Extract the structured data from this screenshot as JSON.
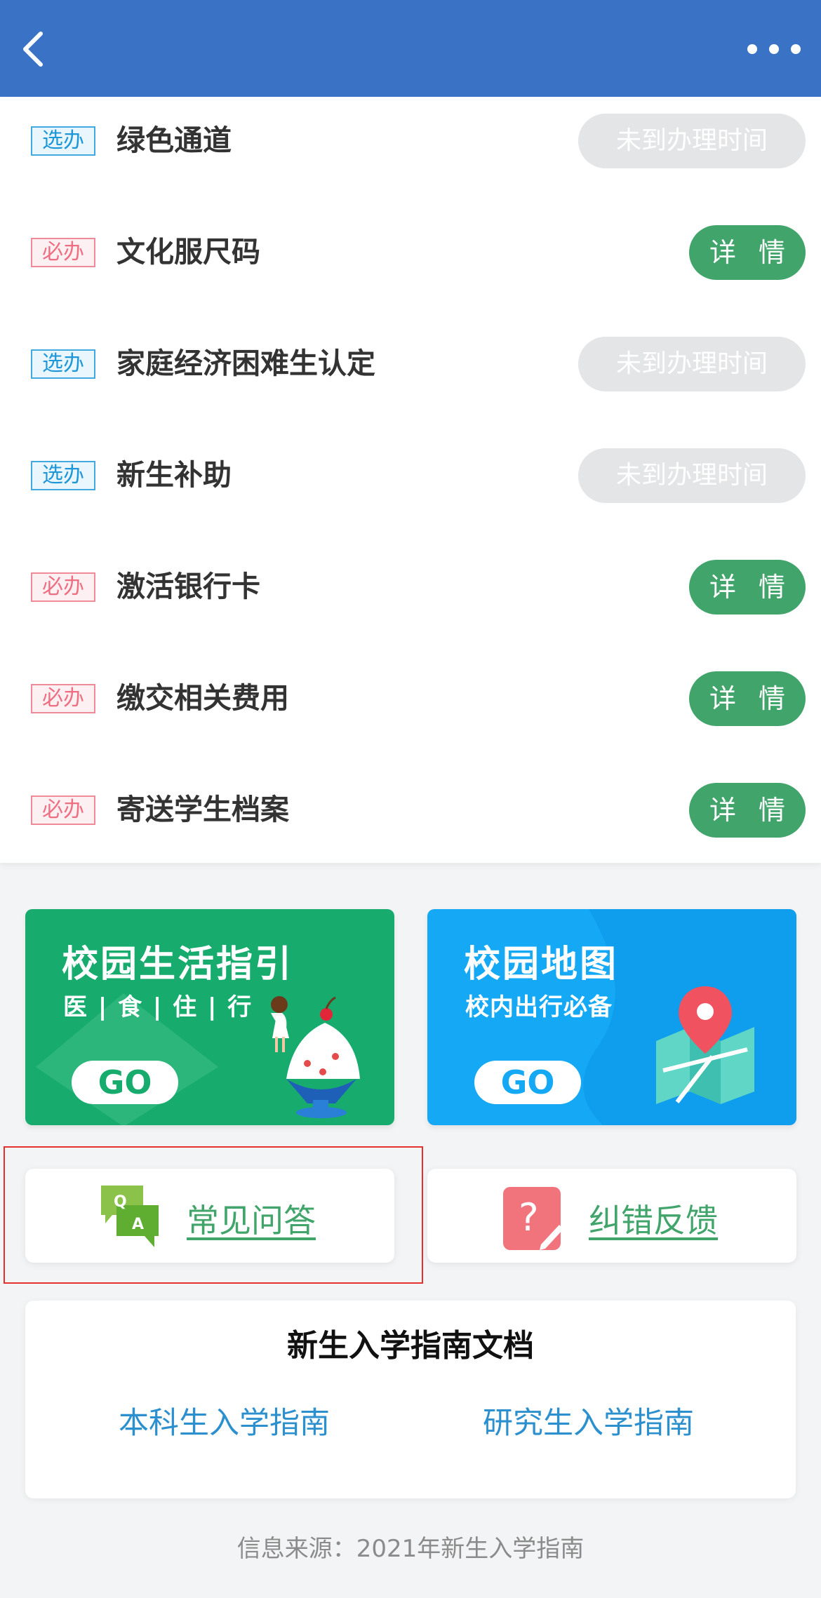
{
  "colors": {
    "header": "#3a73c6",
    "detail_button": "#41a46a",
    "waiting_button": "#e4e5e7",
    "optional_tag": "#1d97d8",
    "required_tag": "#ee6f82",
    "link_blue": "#2c8fce",
    "highlight_box": "#e5302f"
  },
  "header": {
    "back_icon": "chevron-left-icon",
    "more_icon": "more-dots-icon"
  },
  "tasks": [
    {
      "tag": "选办",
      "title": "绿色通道",
      "action": "未到办理时间"
    },
    {
      "tag": "必办",
      "title": "文化服尺码",
      "action": "详 情"
    },
    {
      "tag": "选办",
      "title": "家庭经济困难生认定",
      "action": "未到办理时间"
    },
    {
      "tag": "选办",
      "title": "新生补助",
      "action": "未到办理时间"
    },
    {
      "tag": "必办",
      "title": "激活银行卡",
      "action": "详 情"
    },
    {
      "tag": "必办",
      "title": "缴交相关费用",
      "action": "详 情"
    },
    {
      "tag": "必办",
      "title": "寄送学生档案",
      "action": "详 情"
    }
  ],
  "banners": {
    "life": {
      "title": "校园生活指引",
      "subtitle": "医 | 食 | 住 | 行",
      "go": "GO"
    },
    "map": {
      "title": "校园地图",
      "subtitle": "校内出行必备",
      "go": "GO"
    }
  },
  "cards": {
    "qa": {
      "label": "常见问答",
      "icon": "qa-chat-icon"
    },
    "feedback": {
      "label": "纠错反馈",
      "icon": "question-edit-icon"
    }
  },
  "docs": {
    "title": "新生入学指南文档",
    "undergrad": "本科生入学指南",
    "grad": "研究生入学指南"
  },
  "footer": "信息来源：2021年新生入学指南"
}
